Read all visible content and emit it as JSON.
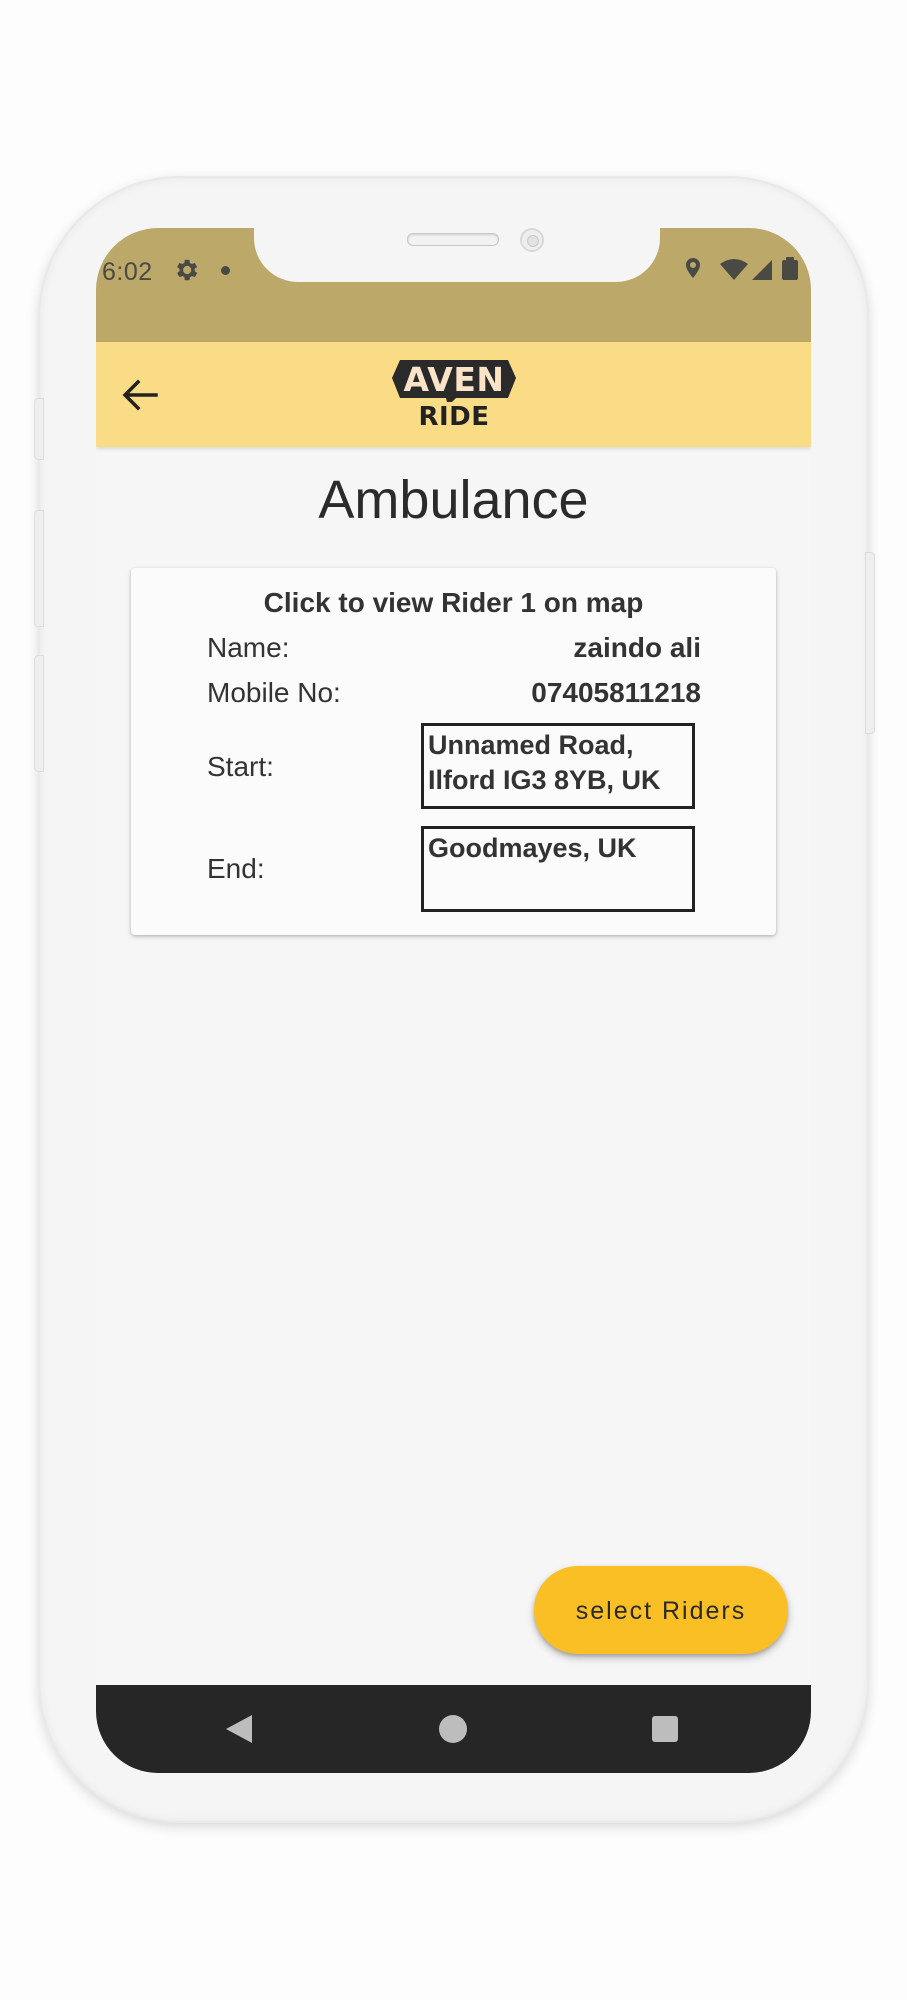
{
  "status_bar": {
    "time": "6:02"
  },
  "app_bar": {
    "logo_top": "AVEN",
    "logo_bottom": "RIDE"
  },
  "page": {
    "title": "Ambulance"
  },
  "rider_card": {
    "heading": "Click to view Rider 1 on map",
    "name_label": "Name:",
    "name_value": "zaindo ali",
    "mobile_label": "Mobile No:",
    "mobile_value": "07405811218",
    "start_label": "Start:",
    "start_value": "Unnamed Road, Ilford IG3 8YB, UK",
    "end_label": "End:",
    "end_value": "Goodmayes, UK"
  },
  "fab": {
    "label": "select Riders"
  },
  "colors": {
    "status_bar": "#bca869",
    "app_bar": "#f9dc85",
    "fab": "#fbbf26",
    "nav_bar": "#262626"
  },
  "icons": {
    "back": "arrow-left-icon",
    "settings": "gear-icon",
    "location": "location-pin-icon",
    "wifi": "wifi-icon",
    "signal": "signal-icon",
    "battery": "battery-icon",
    "nav_back": "triangle-back-icon",
    "nav_home": "circle-home-icon",
    "nav_recents": "square-recents-icon"
  }
}
